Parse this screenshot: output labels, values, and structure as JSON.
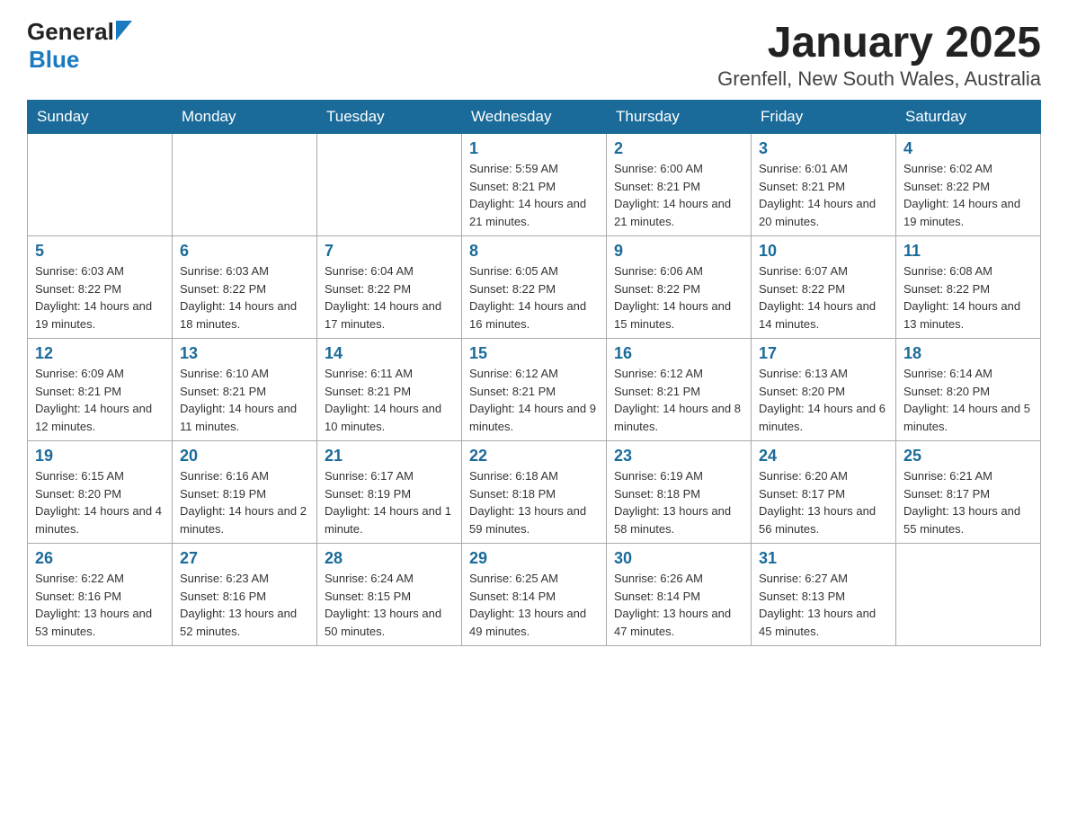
{
  "header": {
    "logo": {
      "general": "General",
      "blue": "Blue",
      "alt": "GeneralBlue logo"
    },
    "title": "January 2025",
    "subtitle": "Grenfell, New South Wales, Australia"
  },
  "calendar": {
    "days_of_week": [
      "Sunday",
      "Monday",
      "Tuesday",
      "Wednesday",
      "Thursday",
      "Friday",
      "Saturday"
    ],
    "weeks": [
      [
        {
          "day": "",
          "info": ""
        },
        {
          "day": "",
          "info": ""
        },
        {
          "day": "",
          "info": ""
        },
        {
          "day": "1",
          "info": "Sunrise: 5:59 AM\nSunset: 8:21 PM\nDaylight: 14 hours and 21 minutes."
        },
        {
          "day": "2",
          "info": "Sunrise: 6:00 AM\nSunset: 8:21 PM\nDaylight: 14 hours and 21 minutes."
        },
        {
          "day": "3",
          "info": "Sunrise: 6:01 AM\nSunset: 8:21 PM\nDaylight: 14 hours and 20 minutes."
        },
        {
          "day": "4",
          "info": "Sunrise: 6:02 AM\nSunset: 8:22 PM\nDaylight: 14 hours and 19 minutes."
        }
      ],
      [
        {
          "day": "5",
          "info": "Sunrise: 6:03 AM\nSunset: 8:22 PM\nDaylight: 14 hours and 19 minutes."
        },
        {
          "day": "6",
          "info": "Sunrise: 6:03 AM\nSunset: 8:22 PM\nDaylight: 14 hours and 18 minutes."
        },
        {
          "day": "7",
          "info": "Sunrise: 6:04 AM\nSunset: 8:22 PM\nDaylight: 14 hours and 17 minutes."
        },
        {
          "day": "8",
          "info": "Sunrise: 6:05 AM\nSunset: 8:22 PM\nDaylight: 14 hours and 16 minutes."
        },
        {
          "day": "9",
          "info": "Sunrise: 6:06 AM\nSunset: 8:22 PM\nDaylight: 14 hours and 15 minutes."
        },
        {
          "day": "10",
          "info": "Sunrise: 6:07 AM\nSunset: 8:22 PM\nDaylight: 14 hours and 14 minutes."
        },
        {
          "day": "11",
          "info": "Sunrise: 6:08 AM\nSunset: 8:22 PM\nDaylight: 14 hours and 13 minutes."
        }
      ],
      [
        {
          "day": "12",
          "info": "Sunrise: 6:09 AM\nSunset: 8:21 PM\nDaylight: 14 hours and 12 minutes."
        },
        {
          "day": "13",
          "info": "Sunrise: 6:10 AM\nSunset: 8:21 PM\nDaylight: 14 hours and 11 minutes."
        },
        {
          "day": "14",
          "info": "Sunrise: 6:11 AM\nSunset: 8:21 PM\nDaylight: 14 hours and 10 minutes."
        },
        {
          "day": "15",
          "info": "Sunrise: 6:12 AM\nSunset: 8:21 PM\nDaylight: 14 hours and 9 minutes."
        },
        {
          "day": "16",
          "info": "Sunrise: 6:12 AM\nSunset: 8:21 PM\nDaylight: 14 hours and 8 minutes."
        },
        {
          "day": "17",
          "info": "Sunrise: 6:13 AM\nSunset: 8:20 PM\nDaylight: 14 hours and 6 minutes."
        },
        {
          "day": "18",
          "info": "Sunrise: 6:14 AM\nSunset: 8:20 PM\nDaylight: 14 hours and 5 minutes."
        }
      ],
      [
        {
          "day": "19",
          "info": "Sunrise: 6:15 AM\nSunset: 8:20 PM\nDaylight: 14 hours and 4 minutes."
        },
        {
          "day": "20",
          "info": "Sunrise: 6:16 AM\nSunset: 8:19 PM\nDaylight: 14 hours and 2 minutes."
        },
        {
          "day": "21",
          "info": "Sunrise: 6:17 AM\nSunset: 8:19 PM\nDaylight: 14 hours and 1 minute."
        },
        {
          "day": "22",
          "info": "Sunrise: 6:18 AM\nSunset: 8:18 PM\nDaylight: 13 hours and 59 minutes."
        },
        {
          "day": "23",
          "info": "Sunrise: 6:19 AM\nSunset: 8:18 PM\nDaylight: 13 hours and 58 minutes."
        },
        {
          "day": "24",
          "info": "Sunrise: 6:20 AM\nSunset: 8:17 PM\nDaylight: 13 hours and 56 minutes."
        },
        {
          "day": "25",
          "info": "Sunrise: 6:21 AM\nSunset: 8:17 PM\nDaylight: 13 hours and 55 minutes."
        }
      ],
      [
        {
          "day": "26",
          "info": "Sunrise: 6:22 AM\nSunset: 8:16 PM\nDaylight: 13 hours and 53 minutes."
        },
        {
          "day": "27",
          "info": "Sunrise: 6:23 AM\nSunset: 8:16 PM\nDaylight: 13 hours and 52 minutes."
        },
        {
          "day": "28",
          "info": "Sunrise: 6:24 AM\nSunset: 8:15 PM\nDaylight: 13 hours and 50 minutes."
        },
        {
          "day": "29",
          "info": "Sunrise: 6:25 AM\nSunset: 8:14 PM\nDaylight: 13 hours and 49 minutes."
        },
        {
          "day": "30",
          "info": "Sunrise: 6:26 AM\nSunset: 8:14 PM\nDaylight: 13 hours and 47 minutes."
        },
        {
          "day": "31",
          "info": "Sunrise: 6:27 AM\nSunset: 8:13 PM\nDaylight: 13 hours and 45 minutes."
        },
        {
          "day": "",
          "info": ""
        }
      ]
    ]
  }
}
